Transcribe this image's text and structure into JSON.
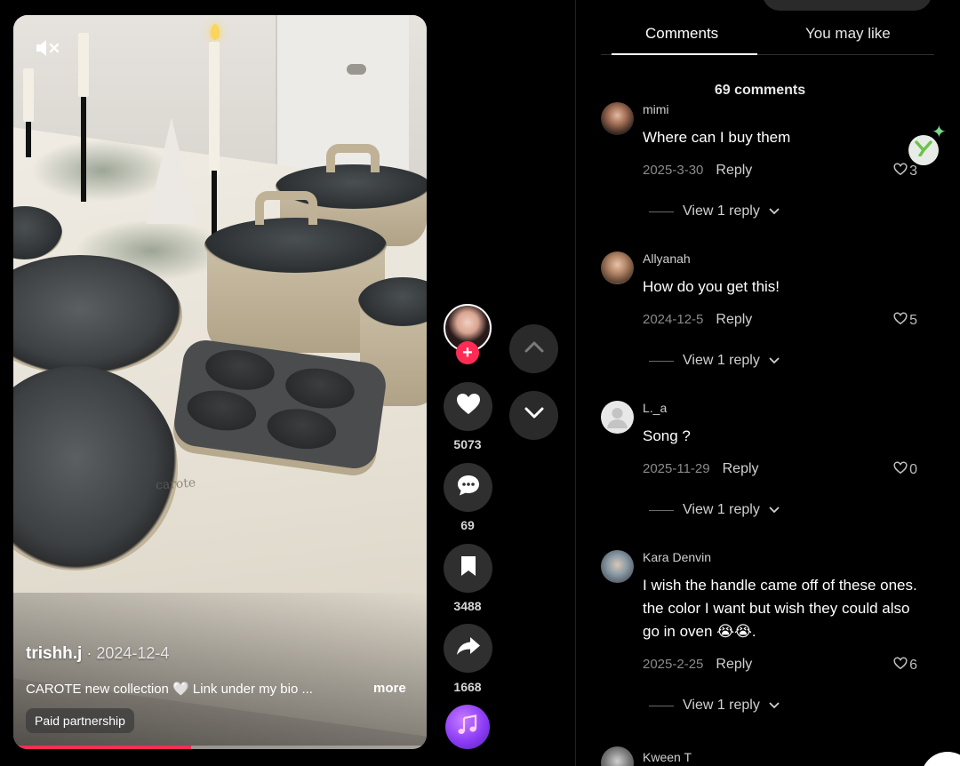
{
  "video": {
    "author": "trishh.j",
    "date_sep": " · ",
    "date": "2024-12-4",
    "caption": "CAROTE new collection 🤍 Link under my bio ...",
    "more_label": "more",
    "paid_label": "Paid partnership",
    "brand_text": "carote",
    "progress_fraction": 0.43
  },
  "actions": {
    "likes": "5073",
    "comments": "69",
    "saves": "3488",
    "shares": "1668"
  },
  "tabs": {
    "comments": "Comments",
    "you_may_like": "You may like"
  },
  "comment_count_label": "69 comments",
  "reply_label": "Reply",
  "comments": [
    {
      "user": "mimi",
      "text": "Where can I buy them",
      "date": "2025-3-30",
      "likes": "3",
      "view_replies": "View 1 reply"
    },
    {
      "user": "Allyanah",
      "text": "How do you get this!",
      "date": "2024-12-5",
      "likes": "5",
      "view_replies": "View 1 reply"
    },
    {
      "user": "L._a",
      "text": "Song ?",
      "date": "2025-11-29",
      "likes": "0",
      "view_replies": "View 1 reply"
    },
    {
      "user": "Kara Denvin",
      "text": "I wish the handle came off of these ones. the color I want but wish they could also go in oven 😭😭.",
      "date": "2025-2-25",
      "likes": "6",
      "view_replies": "View 1 reply"
    },
    {
      "user": "Kween T"
    }
  ],
  "colors": {
    "accent": "#fe2c55",
    "music": "#8b3cf6",
    "badge": "#6cc24a"
  },
  "icons": [
    "mute-icon",
    "heart-icon",
    "comment-icon",
    "bookmark-icon",
    "share-icon",
    "music-note-icon",
    "chevron-up-icon",
    "chevron-down-icon",
    "heart-outline-icon"
  ]
}
